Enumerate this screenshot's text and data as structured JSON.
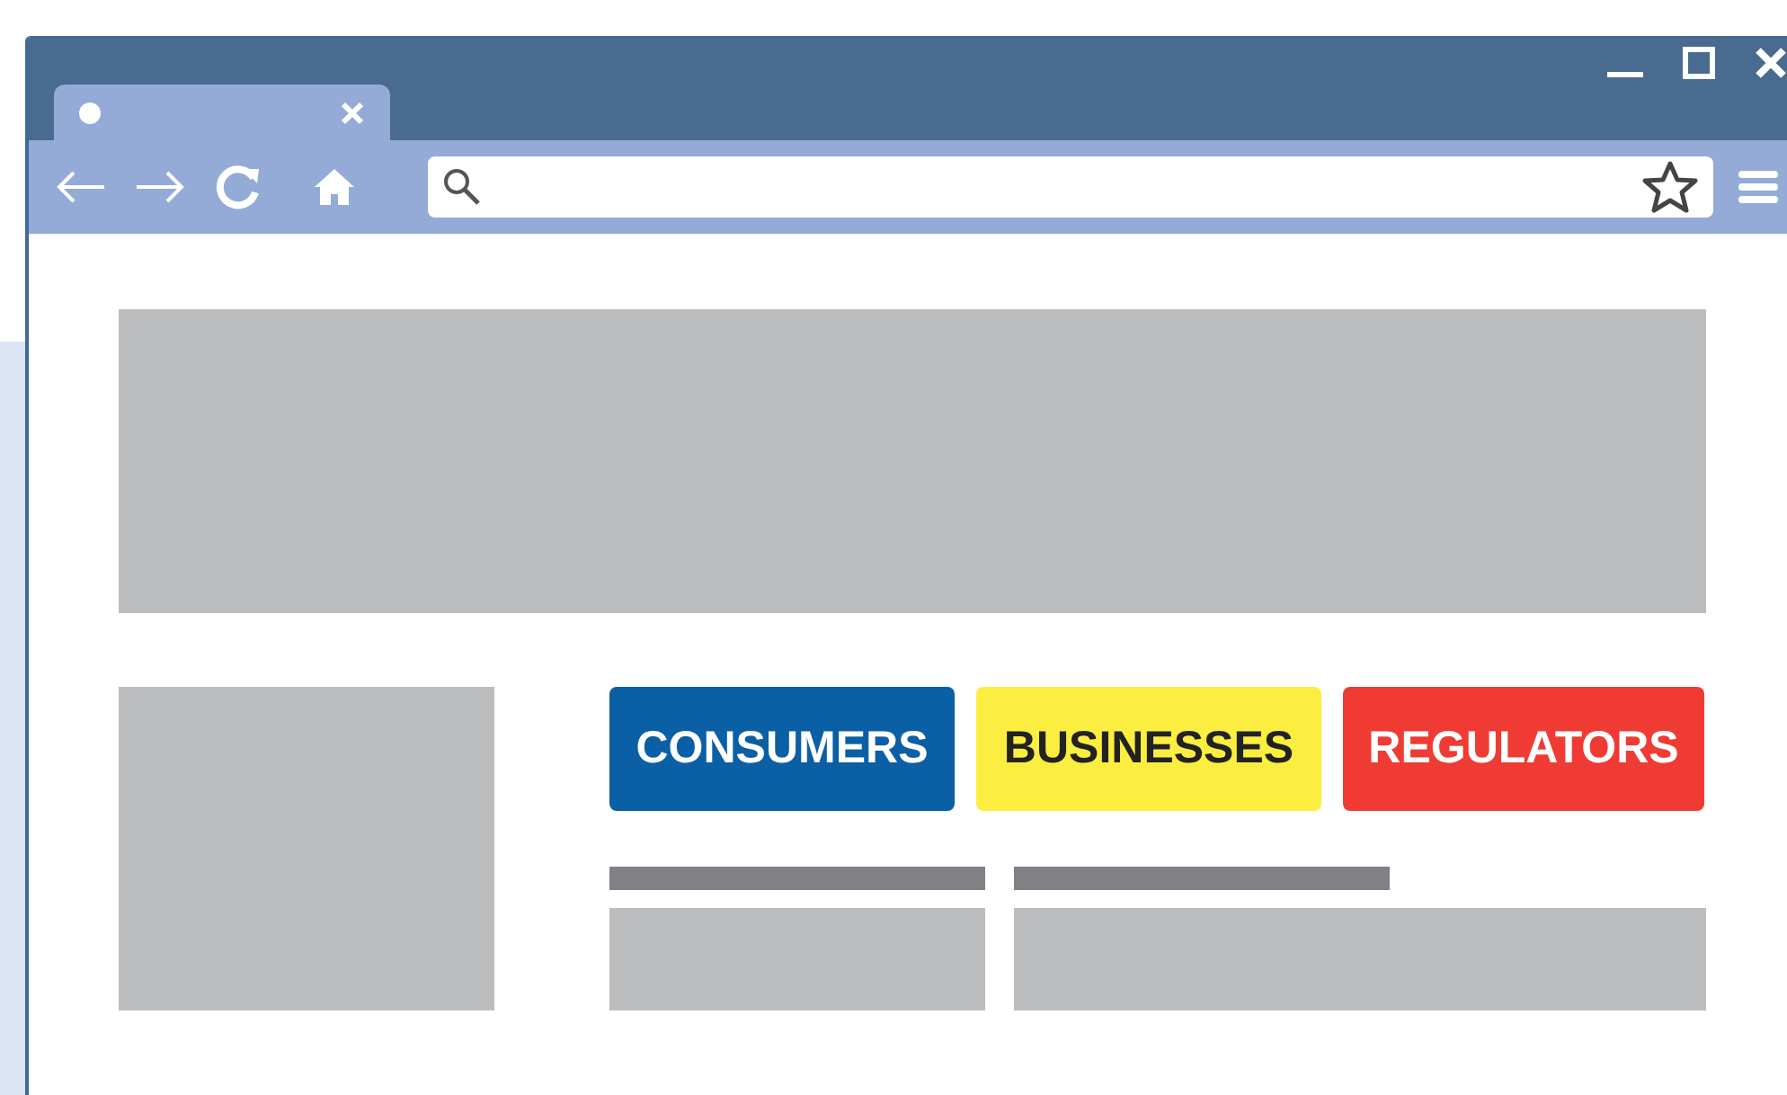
{
  "tabs": [
    {
      "selected": true
    }
  ],
  "buttons": [
    {
      "label": "CONSUMERS",
      "color": "#0b5fa5"
    },
    {
      "label": "BUSINESSES",
      "color": "#fcee41"
    },
    {
      "label": "REGULATORS",
      "color": "#ef3b33"
    }
  ]
}
